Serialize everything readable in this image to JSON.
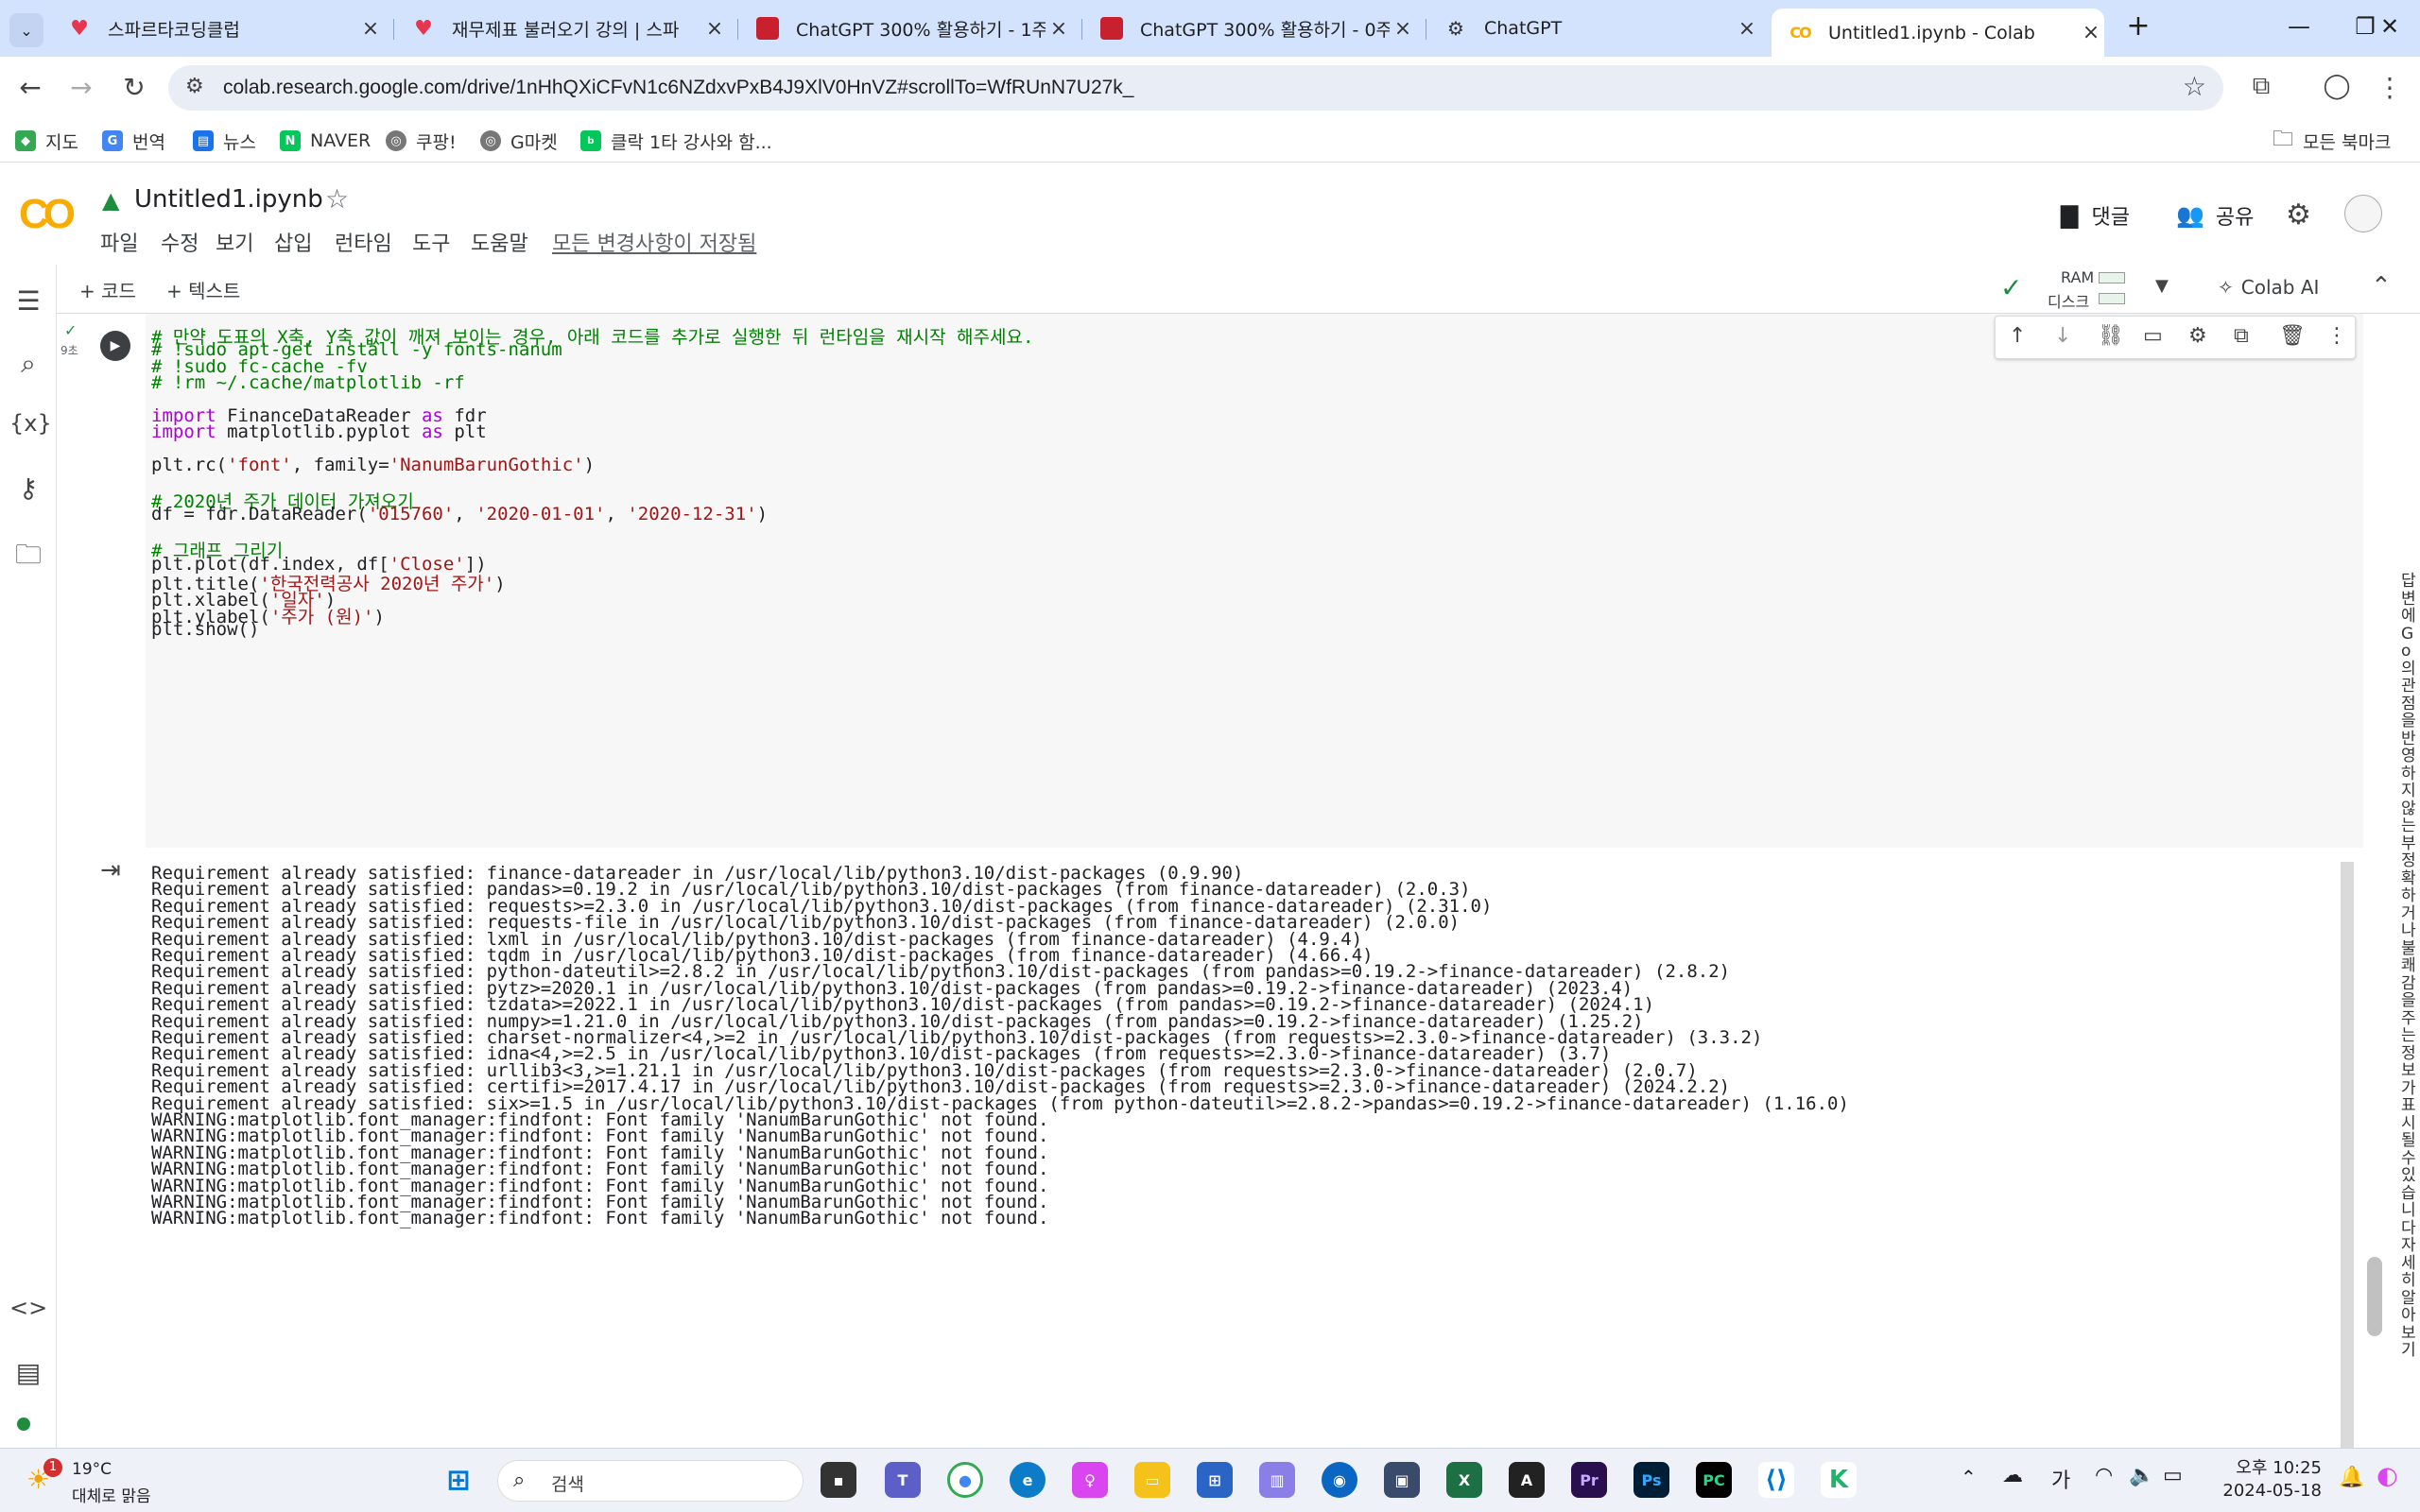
{
  "browser": {
    "tabs": [
      {
        "title": "스파르타코딩클럽",
        "active": false
      },
      {
        "title": "재무제표 불러오기 강의 | 스파",
        "active": false
      },
      {
        "title": "ChatGPT 300% 활용하기 - 1주",
        "active": false
      },
      {
        "title": "ChatGPT 300% 활용하기 - 0주",
        "active": false
      },
      {
        "title": "ChatGPT",
        "active": false
      },
      {
        "title": "Untitled1.ipynb - Colab",
        "active": true
      }
    ],
    "new_tab": "+",
    "url": "colab.research.google.com/drive/1nHhQXiCFvN1c6NZdxvPxB4J9XlV0HnVZ#scrollTo=WfRUnN7U27k_",
    "bookmarks": [
      "지도",
      "번역",
      "뉴스",
      "NAVER",
      "쿠팡!",
      "G마켓",
      "클락 1타 강사와 함..."
    ],
    "all_bookmarks": "모든 북마크"
  },
  "colab": {
    "notebook_title": "Untitled1.ipynb",
    "menus": [
      "파일",
      "수정",
      "보기",
      "삽입",
      "런타임",
      "도구",
      "도움말"
    ],
    "saved_status": "모든 변경사항이 저장됨",
    "comment_label": "댓글",
    "share_label": "공유",
    "add_code": "+ 코드",
    "add_text": "+ 텍스트",
    "ram_label": "RAM",
    "disk_label": "디스크",
    "colab_ai": "Colab AI",
    "exec_time": "9초"
  },
  "code_lines": [
    "# 만약 도표의 X축, Y축 값이 깨져 보이는 경우, 아래 코드를 추가로 실행한 뒤 런타임을 재시작 해주세요.",
    "# !sudo apt-get install -y fonts-nanum",
    "# !sudo fc-cache -fv",
    "# !rm ~/.cache/matplotlib -rf",
    "",
    "import FinanceDataReader as fdr",
    "import matplotlib.pyplot as plt",
    "",
    "plt.rc('font', family='NanumBarunGothic')",
    "",
    "# 2020년 주가 데이터 가져오기",
    "df = fdr.DataReader('015760', '2020-01-01', '2020-12-31')",
    "",
    "# 그래프 그리기",
    "plt.plot(df.index, df['Close'])",
    "plt.title('한국전력공사 2020년 주가')",
    "plt.xlabel('일자')",
    "plt.ylabel('주가 (원)')",
    "plt.show()"
  ],
  "output_lines": [
    "Requirement already satisfied: finance-datareader in /usr/local/lib/python3.10/dist-packages (0.9.90)",
    "Requirement already satisfied: pandas>=0.19.2 in /usr/local/lib/python3.10/dist-packages (from finance-datareader) (2.0.3)",
    "Requirement already satisfied: requests>=2.3.0 in /usr/local/lib/python3.10/dist-packages (from finance-datareader) (2.31.0)",
    "Requirement already satisfied: requests-file in /usr/local/lib/python3.10/dist-packages (from finance-datareader) (2.0.0)",
    "Requirement already satisfied: lxml in /usr/local/lib/python3.10/dist-packages (from finance-datareader) (4.9.4)",
    "Requirement already satisfied: tqdm in /usr/local/lib/python3.10/dist-packages (from finance-datareader) (4.66.4)",
    "Requirement already satisfied: python-dateutil>=2.8.2 in /usr/local/lib/python3.10/dist-packages (from pandas>=0.19.2->finance-datareader) (2.8.2)",
    "Requirement already satisfied: pytz>=2020.1 in /usr/local/lib/python3.10/dist-packages (from pandas>=0.19.2->finance-datareader) (2023.4)",
    "Requirement already satisfied: tzdata>=2022.1 in /usr/local/lib/python3.10/dist-packages (from pandas>=0.19.2->finance-datareader) (2024.1)",
    "Requirement already satisfied: numpy>=1.21.0 in /usr/local/lib/python3.10/dist-packages (from pandas>=0.19.2->finance-datareader) (1.25.2)",
    "Requirement already satisfied: charset-normalizer<4,>=2 in /usr/local/lib/python3.10/dist-packages (from requests>=2.3.0->finance-datareader) (3.3.2)",
    "Requirement already satisfied: idna<4,>=2.5 in /usr/local/lib/python3.10/dist-packages (from requests>=2.3.0->finance-datareader) (3.7)",
    "Requirement already satisfied: urllib3<3,>=1.21.1 in /usr/local/lib/python3.10/dist-packages (from requests>=2.3.0->finance-datareader) (2.0.7)",
    "Requirement already satisfied: certifi>=2017.4.17 in /usr/local/lib/python3.10/dist-packages (from requests>=2.3.0->finance-datareader) (2024.2.2)",
    "Requirement already satisfied: six>=1.5 in /usr/local/lib/python3.10/dist-packages (from python-dateutil>=2.8.2->pandas>=0.19.2->finance-datareader) (1.16.0)",
    "WARNING:matplotlib.font_manager:findfont: Font family 'NanumBarunGothic' not found.",
    "WARNING:matplotlib.font_manager:findfont: Font family 'NanumBarunGothic' not found.",
    "WARNING:matplotlib.font_manager:findfont: Font family 'NanumBarunGothic' not found.",
    "WARNING:matplotlib.font_manager:findfont: Font family 'NanumBarunGothic' not found.",
    "WARNING:matplotlib.font_manager:findfont: Font family 'NanumBarunGothic' not found.",
    "WARNING:matplotlib.font_manager:findfont: Font family 'NanumBarunGothic' not found.",
    "WARNING:matplotlib.font_manager:findfont: Font family 'NanumBarunGothic' not found."
  ],
  "right_panel_text": "답변에Go의관점을반영하지않는부정확하거나불쾌감을주는정보가표시될수있습니다자세히알아보기",
  "taskbar": {
    "weather_temp": "19°C",
    "weather_desc": "대체로 맑음",
    "weather_badge": "1",
    "search_placeholder": "검색",
    "ime": "가",
    "time": "오후 10:25",
    "date": "2024-05-18"
  },
  "colors": {
    "tabstrip_bg": "#d3e3fd",
    "code_comment": "#008000",
    "code_keyword": "#af00db",
    "code_string": "#a31515",
    "colab_orange": "#f9ab00"
  }
}
